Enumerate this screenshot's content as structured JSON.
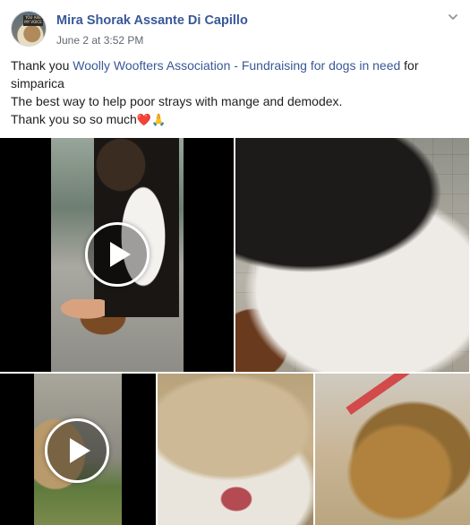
{
  "post": {
    "author": "Mira Shorak Assante Di Capillo",
    "timestamp": "June 2 at 3:52 PM",
    "avatar_sign_text": "YOU ARE MY VOICE",
    "text": {
      "line1_prefix": "Thank you ",
      "line1_link": "Woolly Woofters Association - Fundraising for dogs in need",
      "line1_suffix": " for simparica",
      "line2": "The best way to help poor strays with mange and demodex.",
      "line3": "Thank you so so much",
      "line3_emoji": [
        "❤️",
        "🙏"
      ]
    }
  },
  "media": [
    {
      "kind": "video",
      "icon": "play-icon"
    },
    {
      "kind": "photo"
    },
    {
      "kind": "video",
      "icon": "play-icon"
    },
    {
      "kind": "photo"
    },
    {
      "kind": "photo"
    }
  ],
  "colors": {
    "link": "#385898",
    "text": "#1c1e21",
    "meta": "#616770"
  },
  "icons": {
    "options": "chevron-down-icon",
    "play": "play-icon"
  }
}
